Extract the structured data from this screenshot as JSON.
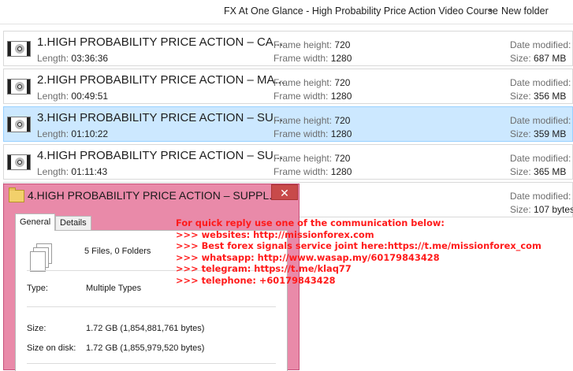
{
  "breadcrumb": {
    "parent": "FX At One Glance - High Probability Price Action Video Course",
    "separator": "▸",
    "current": "New folder"
  },
  "files": [
    {
      "name": "1.HIGH PROBABILITY PRICE ACTION – CA...",
      "length_label": "Length:",
      "length": "03:36:36",
      "fh_label": "Frame height:",
      "fh": "720",
      "fw_label": "Frame width:",
      "fw": "1280",
      "date_label": "Date modified:",
      "size_label": "Size:",
      "size": "687 MB",
      "selected": false
    },
    {
      "name": "2.HIGH PROBABILITY PRICE ACTION – MA...",
      "length_label": "Length:",
      "length": "00:49:51",
      "fh_label": "Frame height:",
      "fh": "720",
      "fw_label": "Frame width:",
      "fw": "1280",
      "date_label": "Date modified:",
      "size_label": "Size:",
      "size": "356 MB",
      "selected": false
    },
    {
      "name": "3.HIGH PROBABILITY PRICE ACTION – SU...",
      "length_label": "Length:",
      "length": "01:10:22",
      "fh_label": "Frame height:",
      "fh": "720",
      "fw_label": "Frame width:",
      "fw": "1280",
      "date_label": "Date modified:",
      "size_label": "Size:",
      "size": "359 MB",
      "selected": true
    },
    {
      "name": "4.HIGH PROBABILITY PRICE ACTION – SU...",
      "length_label": "Length:",
      "length": "01:11:43",
      "fh_label": "Frame height:",
      "fh": "720",
      "fw_label": "Frame width:",
      "fw": "1280",
      "date_label": "Date modified:",
      "size_label": "Size:",
      "size": "365 MB",
      "selected": false
    },
    {
      "name": "",
      "length_label": "",
      "length": "",
      "fh_label": "",
      "fh": "",
      "fw_label": "",
      "fw": "",
      "date_label": "Date modified:",
      "size_label": "Size:",
      "size": "107 bytes",
      "selected": false
    }
  ],
  "properties": {
    "title": "4.HIGH PROBABILITY PRICE ACTION – SUPPL...",
    "close": "✕",
    "tabs": [
      "General",
      "Details"
    ],
    "active_tab": "General",
    "summary": "5 Files, 0 Folders",
    "type_label": "Type:",
    "type_value": "Multiple Types",
    "size_label": "Size:",
    "size_value": "1.72 GB (1,854,881,761 bytes)",
    "disk_label": "Size on disk:",
    "disk_value": "1.72 GB (1,855,979,520 bytes)"
  },
  "overlay": {
    "color": "#ff1a1a",
    "lines": [
      "For quick reply use one of the communication below:",
      ">>> websites: http://missionforex.com",
      ">>> Best forex signals service joint here:https://t.me/missionforex_com",
      ">>> whatsapp: http://www.wasap.my/60179843428",
      ">>> telegram: https://t.me/klaq77",
      ">>> telephone: +60179843428"
    ]
  },
  "colors": {
    "selected_row": "#cce8ff",
    "dialog_frame": "#e98aa9",
    "close_button": "#c84a4a"
  }
}
